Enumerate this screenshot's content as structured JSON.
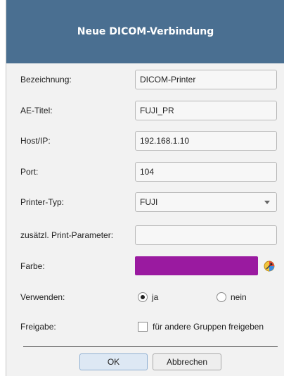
{
  "dialog": {
    "title": "Neue DICOM-Verbindung"
  },
  "form": {
    "bezeichnung": {
      "label": "Bezeichnung:",
      "value": "DICOM-Printer"
    },
    "ae_titel": {
      "label": "AE-Titel:",
      "value": "FUJI_PR"
    },
    "host": {
      "label": "Host/IP:",
      "value": "192.168.1.10"
    },
    "port": {
      "label": "Port:",
      "value": "104"
    },
    "printer_typ": {
      "label": "Printer-Typ:",
      "value": "FUJI"
    },
    "print_params": {
      "label": "zusätzl. Print-Parameter:",
      "value": ""
    },
    "farbe": {
      "label": "Farbe:",
      "color": "#9a1aa0",
      "picker_icon": "color-picker-icon"
    },
    "verwenden": {
      "label": "Verwenden:",
      "option_yes": "ja",
      "option_no": "nein",
      "selected": "ja"
    },
    "freigabe": {
      "label": "Freigabe:",
      "checkbox_label": "für andere Gruppen freigeben",
      "checked": false
    }
  },
  "buttons": {
    "ok": "OK",
    "cancel": "Abbrechen"
  },
  "colors": {
    "titlebar": "#4a6f91",
    "background": "#f2f2f2"
  }
}
